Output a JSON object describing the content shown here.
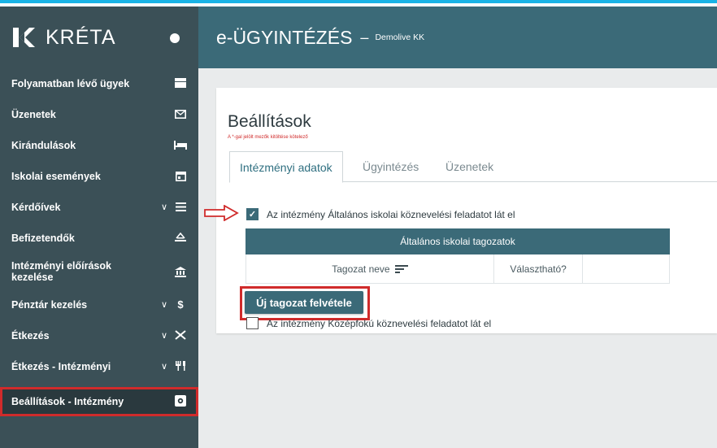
{
  "brand": {
    "name": "KRÉTA"
  },
  "header": {
    "title": "e-ÜGYINTÉZÉS",
    "separator": "–",
    "school": "Demolive KK"
  },
  "sidebar": {
    "items": [
      {
        "label": "Folyamatban lévő ügyek",
        "icon": "stack-icon"
      },
      {
        "label": "Üzenetek",
        "icon": "mail-icon"
      },
      {
        "label": "Kirándulások",
        "icon": "bed-icon"
      },
      {
        "label": "Iskolai események",
        "icon": "calendar-icon"
      },
      {
        "label": "Kérdőívek",
        "icon": "list-icon",
        "expandable": true
      },
      {
        "label": "Befizetendők",
        "icon": "scale-icon"
      },
      {
        "label": "Intézményi előírások kezelése",
        "icon": "institution-icon"
      },
      {
        "label": "Pénztár kezelés",
        "icon": "dollar-icon",
        "expandable": true
      },
      {
        "label": "Étkezés",
        "icon": "cutlery-cross-icon",
        "expandable": true
      },
      {
        "label": "Étkezés - Intézményi",
        "icon": "cutlery-icon",
        "expandable": true
      },
      {
        "label": "Beállítások - Intézmény",
        "icon": "settings-icon",
        "active": true
      }
    ]
  },
  "page": {
    "title": "Beállítások",
    "required_note": "A *-gal jelölt mezők kitöltése kötelező",
    "tabs": [
      "Intézményi adatok",
      "Ügyintézés",
      "Üzenetek"
    ],
    "active_tab": "Intézményi adatok",
    "checkbox_primary": {
      "label": "Az intézmény Általános iskolai köznevelési feladatot lát el",
      "checked": true
    },
    "table": {
      "title": "Általános iskolai tagozatok",
      "columns": [
        "Tagozat neve",
        "Választható?",
        ""
      ]
    },
    "new_button": "Új tagozat felvétele",
    "checkbox_secondary": {
      "label": "Az intézmény Középfokú köznevelési feladatot lát el",
      "checked": false
    }
  },
  "colors": {
    "sidebar": "#3b5057",
    "header": "#3b6a78",
    "accent": "#3b6a78",
    "highlight": "#d02b2b",
    "top_bar": "#1ab3e6"
  }
}
